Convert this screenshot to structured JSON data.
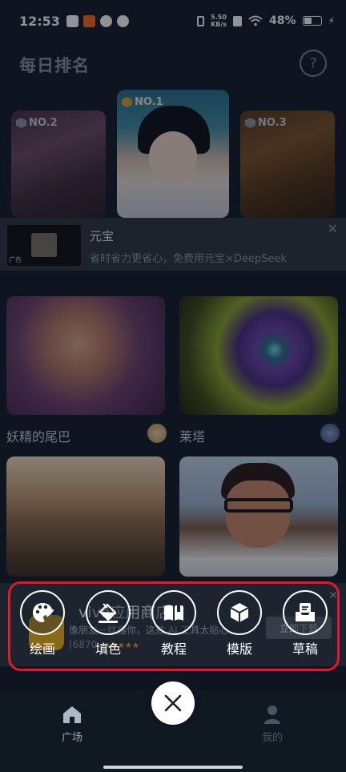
{
  "status_bar": {
    "time": "12:53",
    "net_speed_value": "5.50",
    "net_speed_unit": "KB/s",
    "battery": "48%"
  },
  "header": {
    "title": "每日排名",
    "help_symbol": "?"
  },
  "ranking": [
    {
      "badge": "NO.1"
    },
    {
      "badge": "NO.2"
    },
    {
      "badge": "NO.3"
    }
  ],
  "ad_banner": {
    "name": "元宝",
    "description": "省时省力更省心，免费用元宝×DeepSeek",
    "tag": "广告",
    "close_symbol": "✕"
  },
  "gallery": [
    {
      "title": "妖精的尾巴"
    },
    {
      "title": "莱塔"
    },
    {
      "title": ""
    },
    {
      "title": ""
    }
  ],
  "app_ad": {
    "name": "vivo应用商店",
    "description": "像朋友一样懂你，这款 AI 工具太贴心",
    "rating_count": "(6870",
    "download_label": "立即下载",
    "close_symbol": "✕"
  },
  "create_menu": {
    "items": [
      {
        "label": "绘画",
        "icon": "palette-icon"
      },
      {
        "label": "填色",
        "icon": "paint-bucket-icon"
      },
      {
        "label": "教程",
        "icon": "book-icon"
      },
      {
        "label": "模版",
        "icon": "box-icon"
      },
      {
        "label": "草稿",
        "icon": "drafts-icon"
      }
    ],
    "highlight_color": "#e0192c"
  },
  "bottom_nav": {
    "home_label": "广场",
    "profile_label": "我的"
  }
}
